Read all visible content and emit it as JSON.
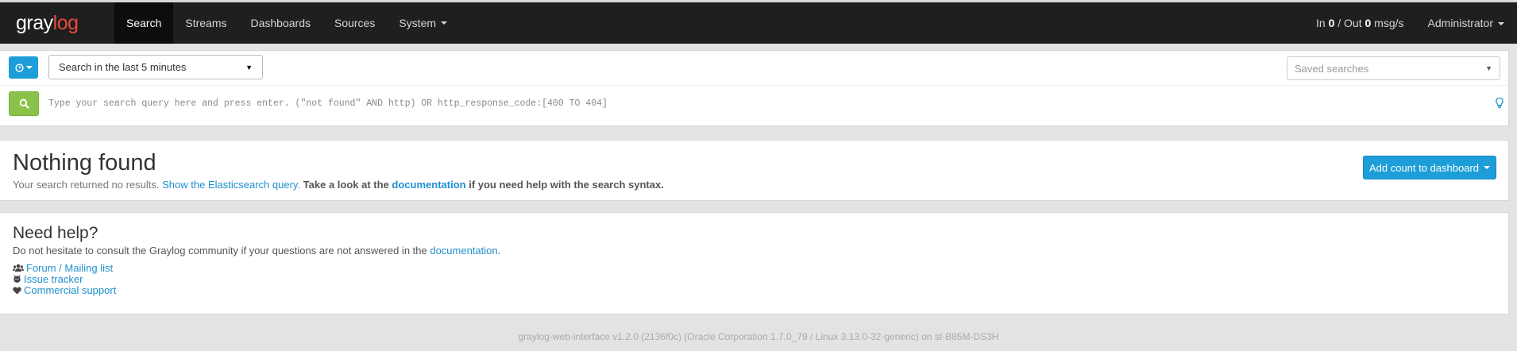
{
  "brand": {
    "logo_part1": "gray",
    "logo_part2": "log"
  },
  "nav": {
    "items": [
      {
        "label": "Search",
        "active": true
      },
      {
        "label": "Streams"
      },
      {
        "label": "Dashboards"
      },
      {
        "label": "Sources"
      },
      {
        "label": "System"
      }
    ],
    "throughput": {
      "in_label": "In ",
      "in_value": "0",
      "out_label": " / Out ",
      "out_value": "0",
      "unit": " msg/s"
    },
    "user": "Administrator"
  },
  "search": {
    "time_range": "Search in the last 5 minutes",
    "saved_searches_placeholder": "Saved searches",
    "query_placeholder": "Type your search query here and press enter. (\"not found\" AND http) OR http_response_code:[400 TO 404]",
    "query_value": ""
  },
  "result": {
    "title": "Nothing found",
    "text_1": "Your search returned no results. ",
    "link_1": "Show the Elasticsearch query",
    "text_2": ". ",
    "bold_1": "Take a look at the ",
    "bold_link": "documentation",
    "bold_2": " if you need help with the search syntax.",
    "add_button": "Add count to dashboard"
  },
  "help": {
    "title": "Need help?",
    "text": "Do not hesitate to consult the Graylog community if your questions are not answered in the ",
    "doc_link": "documentation",
    "text_end": ".",
    "links": [
      {
        "label": "Forum / Mailing list",
        "icon": "users-icon"
      },
      {
        "label": "Issue tracker",
        "icon": "github-icon"
      },
      {
        "label": "Commercial support",
        "icon": "heart-icon"
      }
    ]
  },
  "footer": "graylog-web-interface v1.2.0 (2136f0c) (Oracle Corporation 1.7.0_79 / Linux 3.13.0-32-generic) on st-B85M-DS3H",
  "colors": {
    "navbar": "#1f1f1f",
    "primary": "#1d9ed8",
    "success": "#8bc34a",
    "link": "#1e90cf",
    "logo_accent": "#e84b3c"
  }
}
